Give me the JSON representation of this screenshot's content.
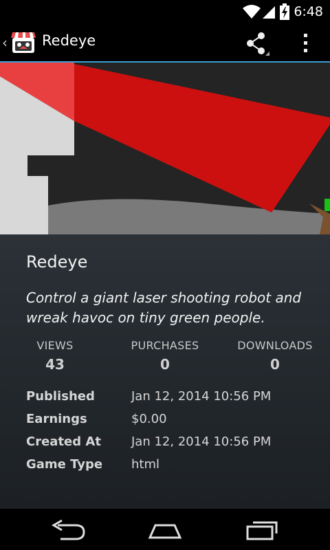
{
  "status_bar": {
    "time": "6:48",
    "icons": [
      "wifi-icon",
      "signal-icon",
      "battery-charging-icon"
    ]
  },
  "action_bar": {
    "title": "Redeye",
    "icons": [
      "up-caret-icon",
      "app-logo-icon",
      "share-icon",
      "overflow-menu-icon"
    ],
    "accent_color": "#3aa2d6"
  },
  "hero": {
    "description": "gameplay screenshot"
  },
  "game": {
    "name": "Redeye",
    "description": "Control a giant laser shooting robot and wreak havoc on tiny green people."
  },
  "stats": [
    {
      "label": "VIEWS",
      "value": "43"
    },
    {
      "label": "PURCHASES",
      "value": "0"
    },
    {
      "label": "DOWNLOADS",
      "value": "0"
    }
  ],
  "info": [
    {
      "label": "Published",
      "value": "Jan 12, 2014 10:56 PM"
    },
    {
      "label": "Earnings",
      "value": "$0.00"
    },
    {
      "label": "Created At",
      "value": "Jan 12, 2014 10:56 PM"
    },
    {
      "label": "Game Type",
      "value": "html"
    }
  ],
  "nav_bar": {
    "icons": [
      "back-icon",
      "home-icon",
      "recents-icon"
    ]
  }
}
